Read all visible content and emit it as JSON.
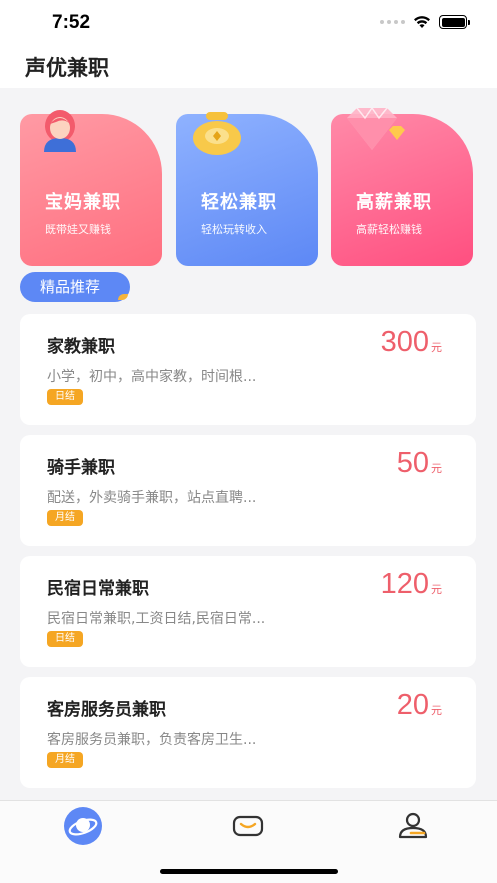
{
  "status_bar": {
    "time": "7:52"
  },
  "app": {
    "title": "声优兼职"
  },
  "categories": [
    {
      "title": "宝妈兼职",
      "subtitle": "既带娃又赚钱",
      "icon": "mother-avatar-icon",
      "color": "#ff7585"
    },
    {
      "title": "轻松兼职",
      "subtitle": "轻松玩转收入",
      "icon": "money-bag-icon",
      "color": "#6a92f7"
    },
    {
      "title": "高薪兼职",
      "subtitle": "高薪轻松赚钱",
      "icon": "diamond-icon",
      "color": "#ff5f8a"
    }
  ],
  "featured": {
    "label": "精品推荐"
  },
  "jobs": [
    {
      "title": "家教兼职",
      "desc": "小学，初中，高中家教，时间根...",
      "tag": "日结",
      "pay": "300",
      "unit": "元"
    },
    {
      "title": "骑手兼职",
      "desc": "配送，外卖骑手兼职，站点直聘...",
      "tag": "月结",
      "pay": "50",
      "unit": "元"
    },
    {
      "title": "民宿日常兼职",
      "desc": "民宿日常兼职,工资日结,民宿日常...",
      "tag": "日结",
      "pay": "120",
      "unit": "元"
    },
    {
      "title": "客房服务员兼职",
      "desc": "客房服务员兼职，负责客房卫生...",
      "tag": "月结",
      "pay": "20",
      "unit": "元"
    }
  ],
  "tab_bar": {
    "tabs": [
      {
        "icon": "planet-icon",
        "active": true
      },
      {
        "icon": "message-icon",
        "active": false
      },
      {
        "icon": "profile-icon",
        "active": false
      }
    ]
  },
  "colors": {
    "accent_blue": "#5d88f5",
    "price_red": "#ee5f6b",
    "tag_orange": "#f5a623"
  }
}
